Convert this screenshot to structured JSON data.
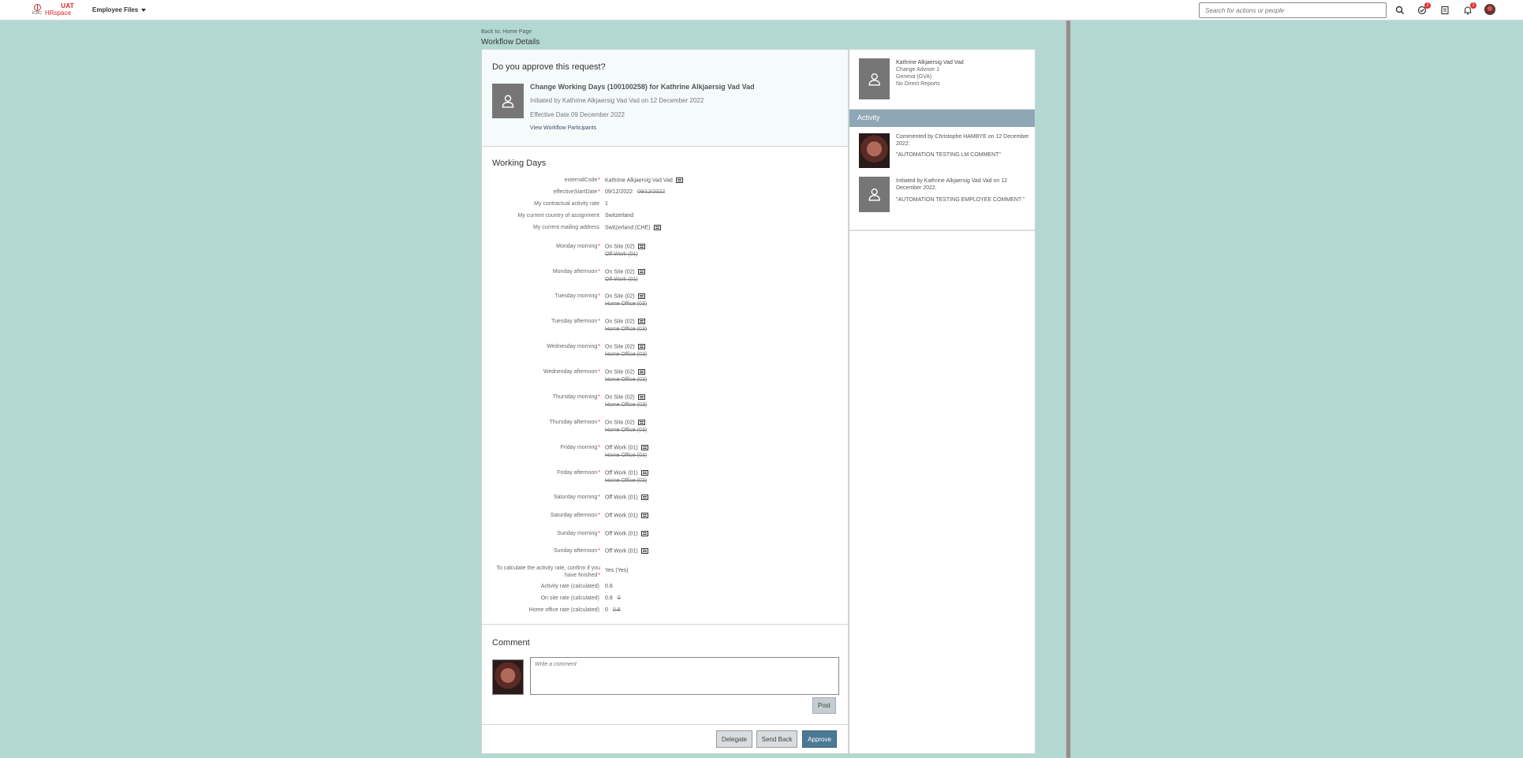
{
  "topbar": {
    "logo_org": "ICRC",
    "logo_env": "UAT",
    "logo_app": "HRspace",
    "menu_label": "Employee Files",
    "search_placeholder": "Search for actions or people",
    "todo_badge": "2",
    "notification_badge": "1",
    "icons": [
      "search-icon",
      "todo-icon",
      "approvals-icon",
      "bell-icon",
      "user-avatar"
    ]
  },
  "header": {
    "back_link": "Back to: Home Page",
    "title": "Workflow Details"
  },
  "request": {
    "question": "Do you approve this request?",
    "title": "Change Working Days (100100258) for Kathrine Alkjaersig Vad Vad",
    "initiated": "Initiated by Kathrine Alkjaersig Vad Vad on 12 December 2022",
    "effective": "Effective Date   09 December 2022",
    "participants_link": "View Workflow Participants"
  },
  "working_days": {
    "title": "Working Days",
    "fields": [
      {
        "label": "externalCode",
        "required": "*",
        "value": "Kathrine Alkjaersig Vad Vad",
        "old": ""
      },
      {
        "label": "effectiveStartDate",
        "required": "*",
        "value": "09/12/2022",
        "old": "09/12/2022"
      },
      {
        "label": "My contractual activity rate",
        "required": "",
        "value": "1",
        "old": ""
      },
      {
        "label": "My current country of assignment",
        "required": "",
        "value": "Switzerland",
        "old": ""
      },
      {
        "label": "My current mailing address",
        "required": "",
        "value": "Switzerland (CHE)",
        "old": ""
      },
      {
        "label": "Monday morning",
        "required": "*",
        "value": "On Site (02)",
        "old": "Off Work (01)"
      },
      {
        "label": "Monday afternoon",
        "required": "*",
        "value": "On Site (02)",
        "old": "Off Work (01)"
      },
      {
        "label": "Tuesday morning",
        "required": "*",
        "value": "On Site (02)",
        "old": "Home Office (03)"
      },
      {
        "label": "Tuesday afternoon",
        "required": "*",
        "value": "On Site (02)",
        "old": "Home Office (03)"
      },
      {
        "label": "Wednesday morning",
        "required": "*",
        "value": "On Site (02)",
        "old": "Home Office (03)"
      },
      {
        "label": "Wednesday afternoon",
        "required": "*",
        "value": "On Site (02)",
        "old": "Home Office (03)"
      },
      {
        "label": "Thursday morning",
        "required": "*",
        "value": "On Site (02)",
        "old": "Home Office (03)"
      },
      {
        "label": "Thursday afternoon",
        "required": "*",
        "value": "On Site (02)",
        "old": "Home Office (03)"
      },
      {
        "label": "Friday morning",
        "required": "*",
        "value": "Off Work (01)",
        "old": "Home Office (03)"
      },
      {
        "label": "Friday afternoon",
        "required": "*",
        "value": "Off Work (01)",
        "old": "Home Office (03)"
      },
      {
        "label": "Saturday morning",
        "required": "*",
        "value": "Off Work (01)",
        "old": ""
      },
      {
        "label": "Saturday afternoon",
        "required": "*",
        "value": "Off Work (01)",
        "old": ""
      },
      {
        "label": "Sunday morning",
        "required": "*",
        "value": "Off Work (01)",
        "old": ""
      },
      {
        "label": "Sunday afternoon",
        "required": "*",
        "value": "Off Work (01)",
        "old": ""
      },
      {
        "label": "To calculate the activity rate, confirm if you have finished",
        "required": "*",
        "value": "Yes (Yes)",
        "old": ""
      },
      {
        "label": "Activity rate (calculated)",
        "required": "",
        "value": "0.8",
        "old": ""
      },
      {
        "label": "On site rate (calculated)",
        "required": "",
        "value": "0.8",
        "old": "0"
      },
      {
        "label": "Home office rate (calculated)",
        "required": "",
        "value": "0",
        "old": "0.8"
      }
    ]
  },
  "comment": {
    "title": "Comment",
    "placeholder": "Write a comment",
    "post_label": "Post"
  },
  "actions": {
    "delegate": "Delegate",
    "send_back": "Send Back",
    "approve": "Approve"
  },
  "profile": {
    "name": "Kathrine Alkjaersig Vad Vad",
    "role": "Change Adviser 1",
    "location": "Geneva (GVA)",
    "reports": "No Direct Reports"
  },
  "activity": {
    "title": "Activity",
    "items": [
      {
        "who": "Commented by Christophe HAMBYE on 12 December 2022:",
        "text": "\"AUTOMATION TESTING LM COMMENT\""
      },
      {
        "who": "Initiated by Kathrine Alkjaersig Vad Vad on 12 December 2022.",
        "text": "\"AUTOMATION TESTING EMPLOYEE COMMENT \""
      }
    ]
  },
  "colors": {
    "background": "#b3d8d1",
    "primary_button": "#4b7894",
    "activity_header": "#8fa7b5",
    "badge": "#e0302b"
  }
}
